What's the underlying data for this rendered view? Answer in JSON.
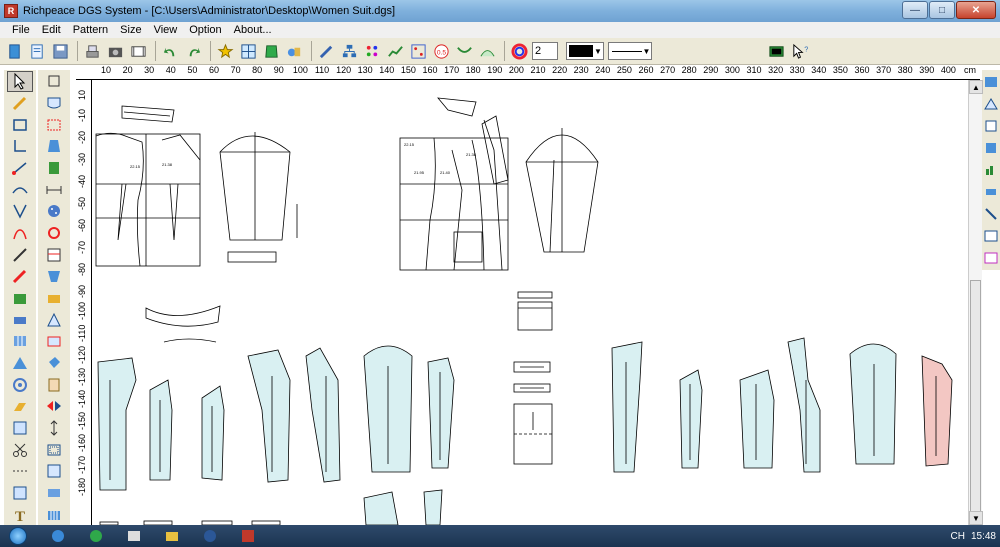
{
  "window": {
    "title": "Richpeace DGS System - [C:\\Users\\Administrator\\Desktop\\Women Suit.dgs]",
    "icon": "richpeace-app-icon",
    "controls": [
      "minimize-icon",
      "maximize-icon",
      "close-icon"
    ]
  },
  "menubar": {
    "items": [
      "File",
      "Edit",
      "Pattern",
      "Size",
      "View",
      "Option",
      "About..."
    ]
  },
  "toolbar": {
    "line_width_value": "2",
    "pen_color": "#000000",
    "line_style": "solid",
    "buttons": [
      "new-file-icon",
      "open-file-icon",
      "save-icon",
      "print-icon",
      "camera-icon",
      "digitizer-icon",
      "undo-icon",
      "redo-icon",
      "grade-rule-icon",
      "grid-icon",
      "piece-fill-icon",
      "measure-icon",
      "brush-icon",
      "hierarchy-icon",
      "color-dots-icon",
      "line-chart-icon",
      "grid-dots-icon",
      "offset-0.5-icon",
      "fold-icon",
      "arc-icon",
      "color-wheel-icon",
      "film-icon",
      "help-cursor-icon"
    ],
    "offset_label": "0.5"
  },
  "ruler_top": {
    "labels": [
      "10",
      "20",
      "30",
      "40",
      "50",
      "60",
      "70",
      "80",
      "90",
      "100",
      "110",
      "120",
      "130",
      "140",
      "150",
      "160",
      "170",
      "180",
      "190",
      "200",
      "210",
      "220",
      "230",
      "240",
      "250",
      "260",
      "270",
      "280",
      "290",
      "300",
      "310",
      "320",
      "330",
      "340",
      "350",
      "360",
      "370",
      "380",
      "390",
      "400",
      "cm"
    ]
  },
  "ruler_left": {
    "labels": [
      "10",
      "-10",
      "-20",
      "-30",
      "-40",
      "-50",
      "-60",
      "-70",
      "-80",
      "-90",
      "-100",
      "-110",
      "-120",
      "-130",
      "-140",
      "-150",
      "-160",
      "-170",
      "-180"
    ]
  },
  "left_palette_a": [
    "select-arrow-icon",
    "pencil-icon",
    "rectangle-icon",
    "right-angle-icon",
    "measure-line-icon",
    "curve-icon",
    "dart-icon",
    "scissors-curve-icon",
    "knife-icon",
    "ruler-pen-icon",
    "piece-cut-icon",
    "sewing-machine-icon",
    "pleat-icon",
    "fan-icon",
    "spiral-icon",
    "tilt-hand-icon",
    "mirror-icon",
    "cut-icon",
    "dashed-line-icon",
    "seam-allowance-icon",
    "text-icon"
  ],
  "left_palette_b": [
    "select-point-icon",
    "pocket-icon",
    "scallop-icon",
    "shirt-icon",
    "collar-icon",
    "button-distance-icon",
    "buttons-icon",
    "hole-icon",
    "stripe-icon",
    "sleeve-icon",
    "facing-icon",
    "darts-triangle-icon",
    "notch-icon",
    "paint-bucket-icon",
    "fold-hand-icon",
    "flip-icon",
    "grain-line-icon",
    "seam-icon",
    "corner-icon",
    "hem-icon",
    "pleat-arrow-icon"
  ],
  "right_palette": [
    "piece-list-icon",
    "shape-icon",
    "shape-alt-icon",
    "shirt-block-icon",
    "chart-icon",
    "drill-icon",
    "marker-icon",
    "layout-icon",
    "view-icon"
  ],
  "canvas": {
    "draft_labels": [
      "22.15",
      "21.38",
      "22.15",
      "21.38",
      "21.95",
      "21.40"
    ],
    "piece_colors": {
      "blue": "#d9f0f2",
      "pink": "#f3c7c3"
    }
  },
  "taskbar": {
    "tray": {
      "language": "CH",
      "time": "15:48"
    },
    "apps": [
      "ie-icon",
      "file-explorer-icon",
      "media-icon",
      "folder-icon",
      "word-icon",
      "dgs-app-icon"
    ]
  }
}
